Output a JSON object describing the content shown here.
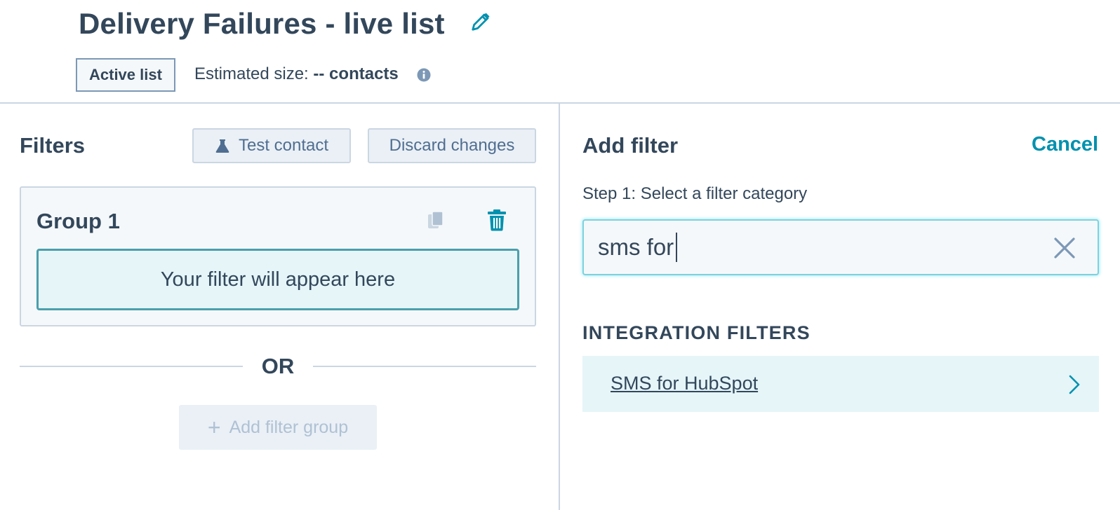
{
  "header": {
    "title": "Delivery Failures - live list",
    "list_type_badge": "Active list",
    "estimated_size_label": "Estimated size:",
    "estimated_size_value": "-- contacts"
  },
  "filters_panel": {
    "title": "Filters",
    "test_contact_label": "Test contact",
    "discard_label": "Discard changes",
    "group": {
      "title": "Group 1",
      "placeholder": "Your filter will appear here"
    },
    "or_label": "OR",
    "add_group_label": "Add filter group"
  },
  "add_filter_panel": {
    "title": "Add filter",
    "cancel_label": "Cancel",
    "step_label": "Step 1: Select a filter category",
    "search_value": "sms for",
    "section_heading": "INTEGRATION FILTERS",
    "results": [
      {
        "label": "SMS for HubSpot"
      }
    ]
  },
  "colors": {
    "text_primary": "#33475b",
    "link": "#0091ae",
    "border": "#cbd6e2",
    "highlight_bg": "#e5f5f8",
    "focus_border": "#7fd1de"
  }
}
